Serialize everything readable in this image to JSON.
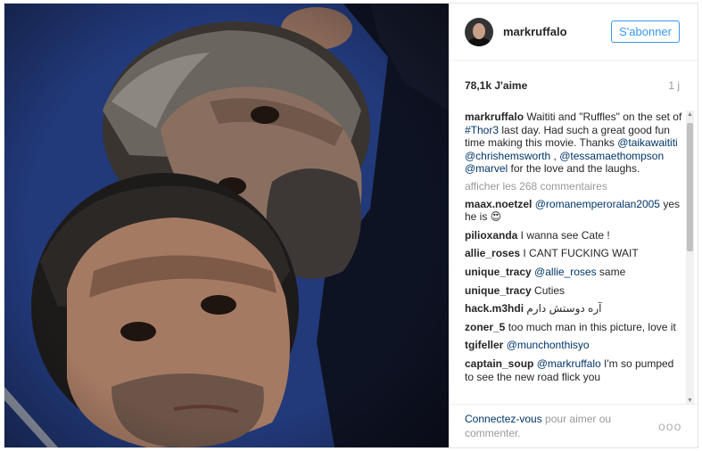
{
  "header": {
    "username": "markruffalo",
    "follow_label": "S'abonner"
  },
  "stats": {
    "likes": "78,1k J'aime",
    "time": "1 j"
  },
  "caption": {
    "user": "markruffalo",
    "text_1": " Waititi and \"Ruffles\" on the set of ",
    "hashtag": "#Thor3",
    "text_2": " last day. Had such a great good fun time making this movie. Thanks ",
    "mention_1": "@taikawaititi",
    "space_1": " ",
    "mention_2": "@chrishemsworth",
    "text_3": " , ",
    "mention_3": "@tessamaethompson",
    "space_2": " ",
    "mention_4": "@marvel",
    "text_4": " for the love and the laughs."
  },
  "view_all": "afficher les 268 commentaires",
  "comments": [
    {
      "user": "maax.noetzel",
      "mention": "@romanemperoralan2005",
      "text": " yes he is 😍"
    },
    {
      "user": "pilioxanda",
      "mention": "",
      "text": " I wanna see Cate !"
    },
    {
      "user": "allie_roses",
      "mention": "",
      "text": " I CANT FUCKING WAIT"
    },
    {
      "user": "unique_tracy",
      "mention": "@allie_roses",
      "text": " same"
    },
    {
      "user": "unique_tracy",
      "mention": "",
      "text": " Cuties"
    },
    {
      "user": "hack.m3hdi",
      "mention": "",
      "text": " آره دوستش دارم"
    },
    {
      "user": "zoner_5",
      "mention": "",
      "text": " too much man in this picture, love it"
    },
    {
      "user": "tgifeller",
      "mention": "@munchonthisyo",
      "text": ""
    },
    {
      "user": "captain_soup",
      "mention": "@markruffalo",
      "text": " I'm so pumped to see the new road flick you"
    }
  ],
  "footer": {
    "login_link": "Connectez-vous",
    "login_text": " pour aimer ou commenter.",
    "more_options": "ooo"
  },
  "scrollbar": {
    "up": "▲",
    "down": "▼"
  }
}
